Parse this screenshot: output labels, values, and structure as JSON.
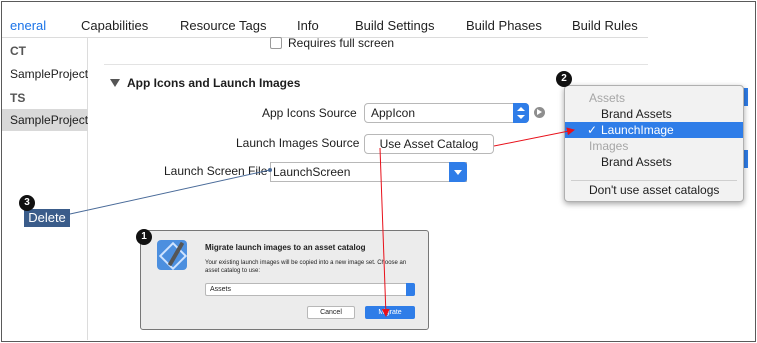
{
  "tabs": [
    {
      "label": "eneral",
      "active": true
    },
    {
      "label": "Capabilities"
    },
    {
      "label": "Resource Tags"
    },
    {
      "label": "Info"
    },
    {
      "label": "Build Settings"
    },
    {
      "label": "Build Phases"
    },
    {
      "label": "Build Rules"
    }
  ],
  "sidebar": {
    "project_header": "CT",
    "project_item": "SampleProject",
    "targets_header": "TS",
    "target_item": "SampleProject"
  },
  "content": {
    "requires_full_screen": "Requires full screen",
    "section_title": "App Icons and Launch Images",
    "app_icons_label": "App Icons Source",
    "app_icons_value": "AppIcon",
    "launch_images_label": "Launch Images Source",
    "launch_images_button": "Use Asset Catalog",
    "launch_screen_label": "Launch Screen File",
    "launch_screen_value": "LaunchScreen"
  },
  "delete_label": "Delete",
  "badges": {
    "one": "1",
    "two": "2",
    "three": "3"
  },
  "menu": {
    "assets_header": "Assets",
    "brand_assets_1": "Brand Assets",
    "launch_image": "LaunchImage",
    "check": "✓",
    "images_header": "Images",
    "brand_assets_2": "Brand Assets",
    "dont_use": "Don't use asset catalogs"
  },
  "dialog": {
    "title": "Migrate launch images to an asset catalog",
    "message": "Your existing launch images will be copied into a new image set. Choose an asset catalog to use:",
    "select_value": "Assets",
    "cancel": "Cancel",
    "migrate": "Migrate"
  },
  "colors": {
    "accent": "#2f7de8",
    "callout_line": "#e8101a",
    "delete_bg": "#3a5c8a"
  }
}
